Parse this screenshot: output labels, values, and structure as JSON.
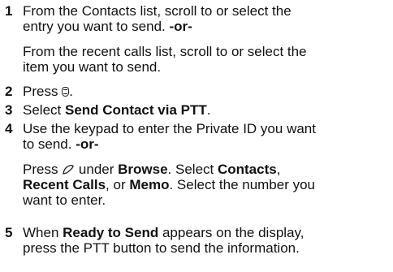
{
  "steps": [
    {
      "number": "1",
      "line1": "From the Contacts list, scroll to or select the",
      "line2a": "entry you want to send. ",
      "line2b": "-or-",
      "alt_line1": "From the recent calls list, scroll to or select the",
      "alt_line2": "item you want to send."
    },
    {
      "number": "2",
      "text_a": "Press ",
      "text_b": "."
    },
    {
      "number": "3",
      "text_a": "Select ",
      "bold": "Send Contact via PTT",
      "text_b": "."
    },
    {
      "number": "4",
      "line1": "Use the keypad to enter the Private ID you want",
      "line2a": "to send. ",
      "line2b": "-or-",
      "alt_a": "Press ",
      "alt_b": " under ",
      "alt_browse": "Browse",
      "alt_c": ". Select ",
      "alt_contacts": "Contacts",
      "alt_d": ",",
      "alt_recent": "Recent Calls",
      "alt_e": ", or ",
      "alt_memo": "Memo",
      "alt_f": ". Select the number you",
      "alt_g": "want to enter."
    },
    {
      "number": "5",
      "line1a": "When ",
      "line1b": "Ready to Send",
      "line1c": " appears on the display,",
      "line2": "press the PTT button to send the information."
    }
  ],
  "icons": [
    "menu-key-icon",
    "softkey-icon"
  ]
}
